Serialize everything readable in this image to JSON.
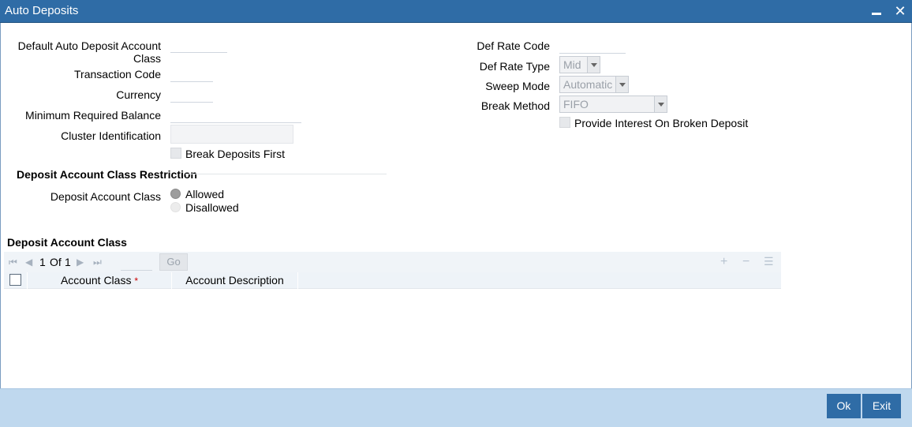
{
  "window": {
    "title": "Auto Deposits"
  },
  "form": {
    "default_auto_deposit_account_class_label_line1": "Default Auto Deposit Account",
    "default_auto_deposit_account_class_label_line2": "Class",
    "transaction_code_label": "Transaction Code",
    "currency_label": "Currency",
    "minimum_required_balance_label": "Minimum Required Balance",
    "cluster_identification_label": "Cluster Identification",
    "break_deposits_first_label": "Break Deposits First",
    "def_rate_code_label": "Def Rate Code",
    "def_rate_type_label": "Def Rate Type",
    "def_rate_type_value": "Mid",
    "sweep_mode_label": "Sweep Mode",
    "sweep_mode_value": "Automatic",
    "break_method_label": "Break Method",
    "break_method_value": "FIFO",
    "provide_interest_label": "Provide Interest On Broken Deposit"
  },
  "restriction": {
    "section_title": "Deposit Account Class Restriction",
    "field_label": "Deposit Account Class",
    "option_allowed": "Allowed",
    "option_disallowed": "Disallowed",
    "selected": "Allowed"
  },
  "grid": {
    "section_title": "Deposit Account Class",
    "pager_current": "1",
    "pager_of": "Of",
    "pager_total": "1",
    "go_label": "Go",
    "columns": [
      {
        "label": "Account Class",
        "required_mark": "*"
      },
      {
        "label": "Account Description"
      }
    ],
    "rows": []
  },
  "footer": {
    "ok_label": "Ok",
    "exit_label": "Exit"
  }
}
